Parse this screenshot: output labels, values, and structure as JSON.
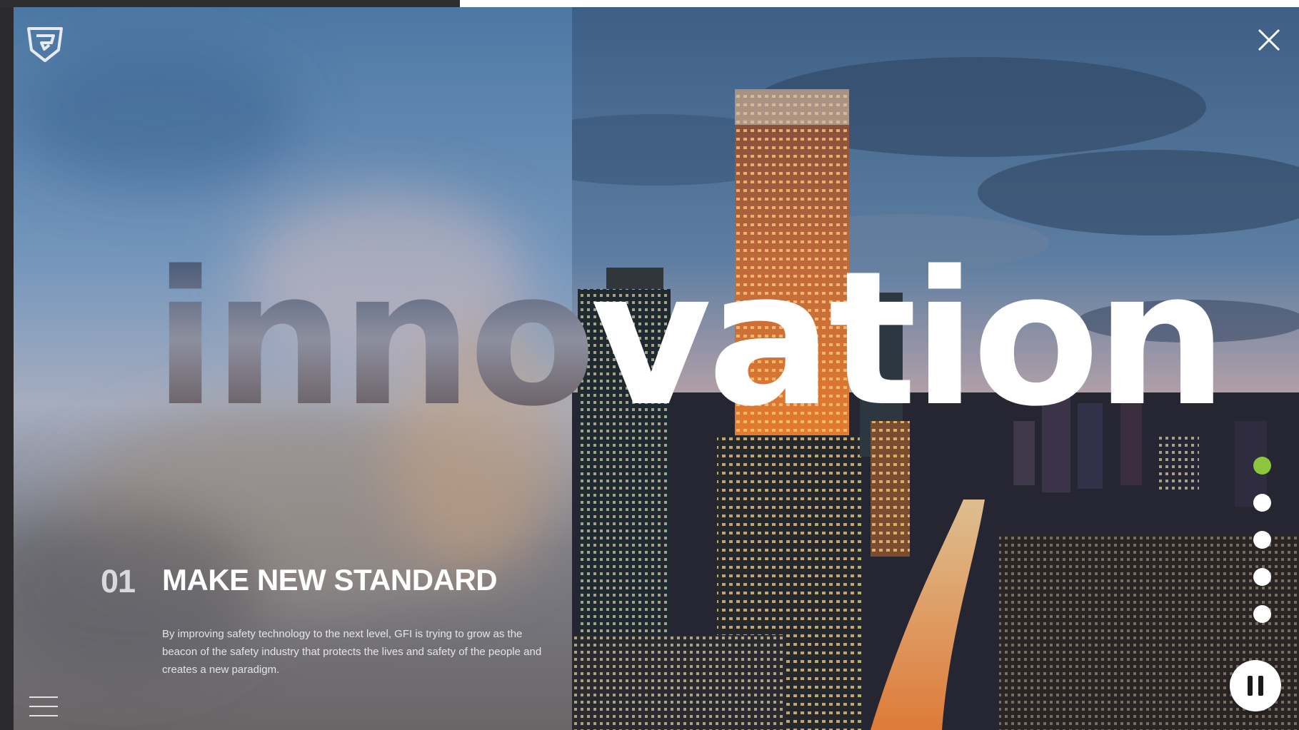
{
  "hero": {
    "word_masked": "inno",
    "word_solid": "vation"
  },
  "slide": {
    "number": "01",
    "title": "MAKE NEW STANDARD",
    "description": "By improving safety technology to the next level, GFI is trying to grow as the beacon of the safety industry that protects the lives and safety of the people and creates a new paradigm."
  },
  "pagination": {
    "total": 5,
    "active_index": 1
  },
  "icons": {
    "logo": "shield-g-logo",
    "close": "close-icon",
    "menu": "hamburger-menu-icon",
    "pause": "pause-icon"
  },
  "colors": {
    "accent": "#8cc63f",
    "white": "#ffffff",
    "frame": "#2b2b2d"
  }
}
